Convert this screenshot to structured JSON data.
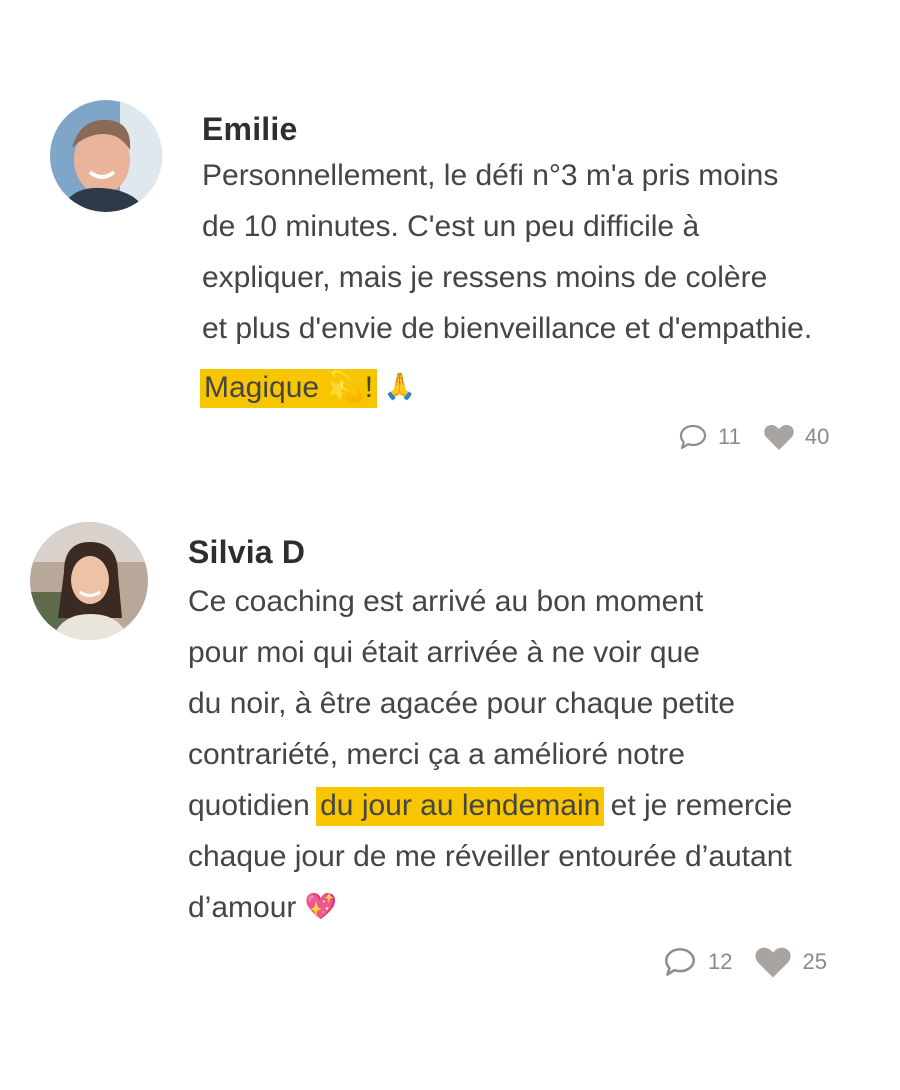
{
  "comments": [
    {
      "author": "Emilie",
      "lines": [
        "Personnellement, le défi n°3 m'a pris moins",
        "de 10 minutes. C'est un peu difficile à",
        "expliquer, mais je ressens moins de colère",
        "et plus d'envie de bienveillance et d'empathie."
      ],
      "last_highlight": "Magique 💫!",
      "last_emoji": "🙏",
      "reply_count": "11",
      "like_count": "40"
    },
    {
      "author": "Silvia D",
      "lines": [
        "Ce coaching est arrivé au bon moment",
        "pour moi qui était arrivée à ne voir que",
        "du noir, à être agacée pour chaque petite",
        "contrariété, merci ça a amélioré  notre"
      ],
      "line5_before": "quotidien ",
      "line5_highlight": "du jour au lendemain",
      "line5_after": " et je remercie",
      "line6": "chaque jour de me réveiller entourée d’autant",
      "line7": "d’amour ",
      "line7_emoji": "💖",
      "reply_count": "12",
      "like_count": "25"
    }
  ],
  "colors": {
    "highlight": "#f7c600",
    "text": "#454545",
    "icon": "#a9a3a1"
  },
  "icons": {
    "reply": "speech-bubble-icon",
    "like": "heart-icon"
  }
}
